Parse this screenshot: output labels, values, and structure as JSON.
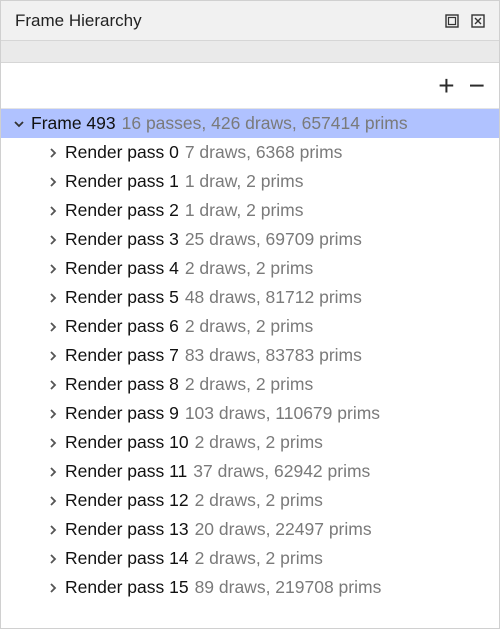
{
  "panel": {
    "title": "Frame Hierarchy"
  },
  "colors": {
    "selection": "#b0c2ff"
  },
  "tree": {
    "root": {
      "label": "Frame 493",
      "meta": "16 passes, 426 draws, 657414 prims",
      "expanded": true
    },
    "children": [
      {
        "label": "Render pass 0",
        "meta": "7 draws, 6368 prims"
      },
      {
        "label": "Render pass 1",
        "meta": "1 draw, 2 prims"
      },
      {
        "label": "Render pass 2",
        "meta": "1 draw, 2 prims"
      },
      {
        "label": "Render pass 3",
        "meta": "25 draws, 69709 prims"
      },
      {
        "label": "Render pass 4",
        "meta": "2 draws, 2 prims"
      },
      {
        "label": "Render pass 5",
        "meta": "48 draws, 81712 prims"
      },
      {
        "label": "Render pass 6",
        "meta": "2 draws, 2 prims"
      },
      {
        "label": "Render pass 7",
        "meta": "83 draws, 83783 prims"
      },
      {
        "label": "Render pass 8",
        "meta": "2 draws, 2 prims"
      },
      {
        "label": "Render pass 9",
        "meta": "103 draws, 110679 prims"
      },
      {
        "label": "Render pass 10",
        "meta": "2 draws, 2 prims"
      },
      {
        "label": "Render pass 11",
        "meta": "37 draws, 62942 prims"
      },
      {
        "label": "Render pass 12",
        "meta": "2 draws, 2 prims"
      },
      {
        "label": "Render pass 13",
        "meta": "20 draws, 22497 prims"
      },
      {
        "label": "Render pass 14",
        "meta": "2 draws, 2 prims"
      },
      {
        "label": "Render pass 15",
        "meta": "89 draws, 219708 prims"
      }
    ]
  }
}
